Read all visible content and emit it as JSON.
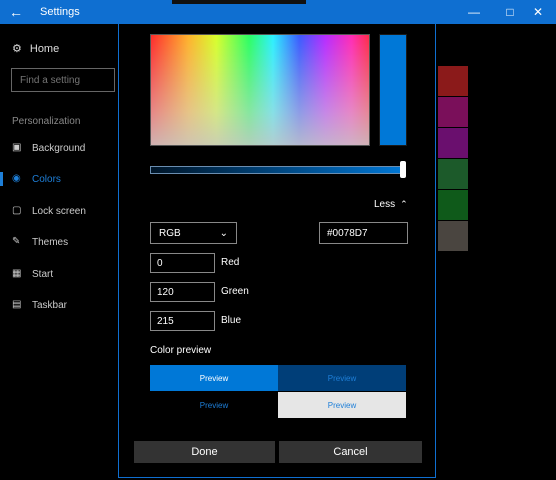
{
  "window": {
    "title": "Settings"
  },
  "sidebar": {
    "home_label": "Home",
    "search_placeholder": "Find a setting",
    "section_label": "Personalization",
    "items": [
      {
        "label": "Background",
        "active": false
      },
      {
        "label": "Colors",
        "active": true
      },
      {
        "label": "Lock screen",
        "active": false
      },
      {
        "label": "Themes",
        "active": false
      },
      {
        "label": "Start",
        "active": false
      },
      {
        "label": "Taskbar",
        "active": false
      }
    ]
  },
  "swatch_colors": [
    "#8b1a1a",
    "#7a0f5a",
    "#6a0f6e",
    "#1c5a2a",
    "#0f5a1a",
    "#4a4540"
  ],
  "dialog": {
    "current_color": "#0078d7",
    "less_label": "Less",
    "mode_select": "RGB",
    "hex_value": "#0078D7",
    "channels": [
      {
        "value": "0",
        "label": "Red"
      },
      {
        "value": "120",
        "label": "Green"
      },
      {
        "value": "215",
        "label": "Blue"
      }
    ],
    "color_preview_label": "Color preview",
    "preview_text": "Preview",
    "done_label": "Done",
    "cancel_label": "Cancel"
  }
}
